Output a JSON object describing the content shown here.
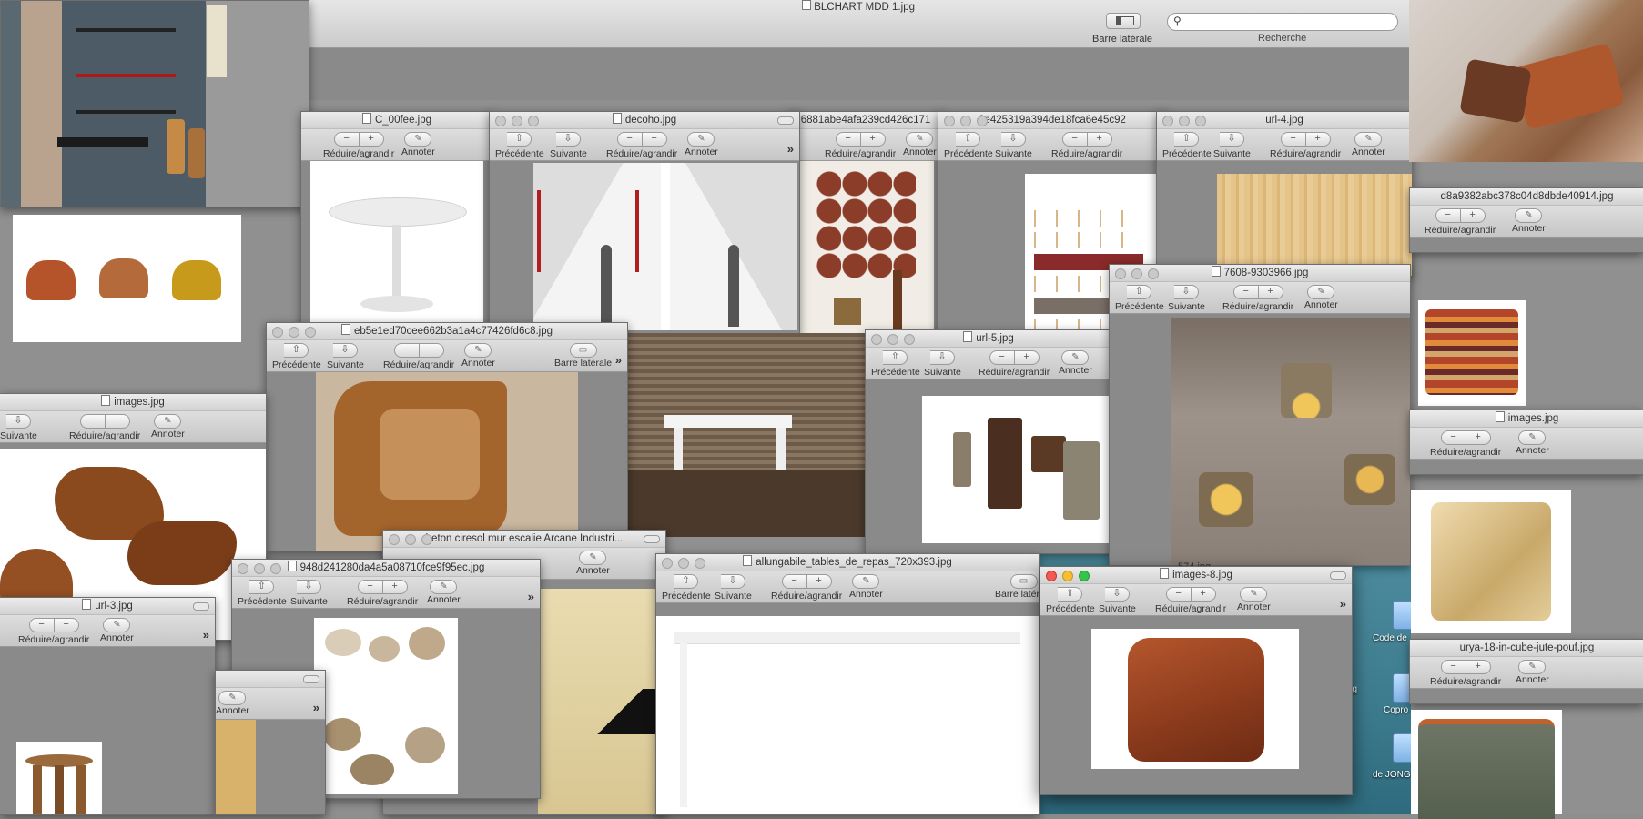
{
  "desktop": {
    "icons": [
      {
        "label": "Code de"
      },
      {
        "label": "Copro"
      },
      {
        "label": "de JONG"
      },
      {
        "label": "pg"
      }
    ]
  },
  "main_window": {
    "title": "BLCHART MDD 1.jpg",
    "sidebar_label": "Barre latérale",
    "search_label": "Recherche",
    "search_value": ""
  },
  "toolbar": {
    "prev": "Précédente",
    "next": "Suivante",
    "zoom": "Réduire/agrandir",
    "annotate": "Annoter",
    "sidebar": "Barre latérale"
  },
  "windows": [
    {
      "id": "w1",
      "title": "C_00fee.jpg"
    },
    {
      "id": "w2",
      "title": "decoho.jpg"
    },
    {
      "id": "w3",
      "title": "6881abe4afa239cd426c171"
    },
    {
      "id": "w4",
      "title": "8e425319a394de18fca6e45c92"
    },
    {
      "id": "w5",
      "title": "url-4.jpg"
    },
    {
      "id": "w6",
      "title": "eb5e1ed70cee662b3a1a4c77426fd6c8.jpg"
    },
    {
      "id": "w7",
      "title": "url-5.jpg"
    },
    {
      "id": "w8",
      "title": "7608-9303966.jpg"
    },
    {
      "id": "w9",
      "title": "images.jpg"
    },
    {
      "id": "w10",
      "title": "beton ciresol mur escalie  Arcane Industri..."
    },
    {
      "id": "w11",
      "title": "948d241280da4a5a08710fce9f95ec.jpg"
    },
    {
      "id": "w12",
      "title": "allungabile_tables_de_repas_720x393.jpg"
    },
    {
      "id": "w13",
      "title": "images-8.jpg"
    },
    {
      "id": "w14",
      "title": "url-3.jpg"
    },
    {
      "id": "w15",
      "title": "d8a9382abc378c04d8dbde40914.jpg"
    },
    {
      "id": "w16",
      "title": "images.jpg"
    },
    {
      "id": "w17",
      "title": "urya-18-in-cube-jute-pouf.jpg"
    },
    {
      "id": "w18",
      "title": "574.jpg"
    }
  ],
  "colors": {
    "desktop_gray": "#8e8e8e",
    "desktop_teal": "#3d7c8e",
    "toolbar_top": "#dedede",
    "close_red": "#f25a54"
  }
}
